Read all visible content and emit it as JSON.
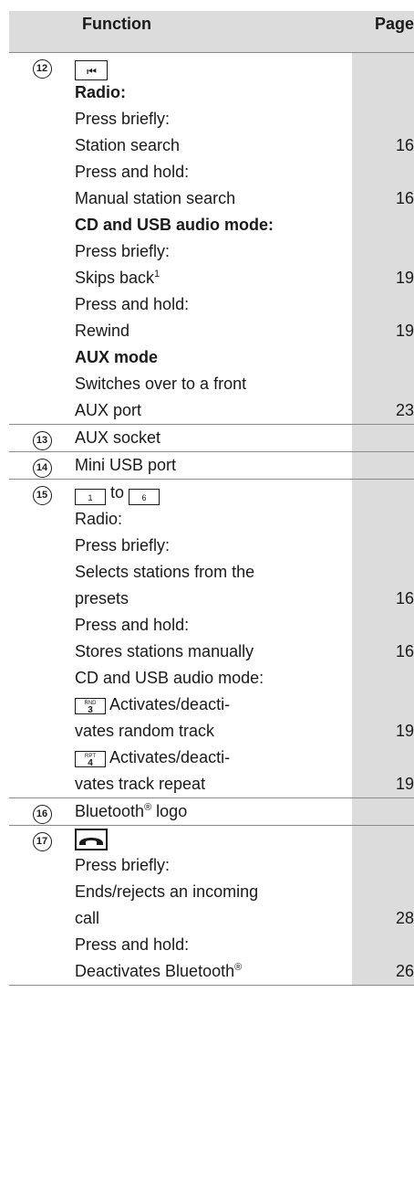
{
  "header": {
    "function": "Function",
    "page": "Page"
  },
  "rows": [
    {
      "num": "12",
      "key": "⏮",
      "lines": [
        {
          "text": "Radio:",
          "bold": true,
          "page": ""
        },
        {
          "text": "Press briefly:",
          "page": ""
        },
        {
          "text": "Station search",
          "page": "16"
        },
        {
          "text": "Press and hold:",
          "page": ""
        },
        {
          "text": "Manual station search",
          "page": "16"
        },
        {
          "text": "CD and USB audio mode:",
          "bold": true,
          "page": ""
        },
        {
          "text": "Press briefly:",
          "page": ""
        },
        {
          "text": "Skips back",
          "sup": "1",
          "page": "19"
        },
        {
          "text": "Press and hold:",
          "page": ""
        },
        {
          "text": "Rewind",
          "page": "19"
        },
        {
          "text": "AUX mode",
          "bold": true,
          "page": ""
        },
        {
          "text": "Switches over to a front",
          "page": ""
        },
        {
          "text": "AUX port",
          "page": "23"
        }
      ]
    },
    {
      "num": "13",
      "lines": [
        {
          "text": "AUX socket",
          "page": ""
        }
      ]
    },
    {
      "num": "14",
      "lines": [
        {
          "text": "Mini USB port",
          "page": ""
        }
      ]
    },
    {
      "num": "15",
      "key_from": "1",
      "key_to_word": "to",
      "key_to": "6",
      "lines": [
        {
          "text": "Radio:",
          "page": ""
        },
        {
          "text": "Press briefly:",
          "page": ""
        },
        {
          "text": "Selects stations from the",
          "page": ""
        },
        {
          "text": "presets",
          "page": "16"
        },
        {
          "text": "Press and hold:",
          "page": ""
        },
        {
          "text": "Stores stations manually",
          "page": "16"
        },
        {
          "text": "CD and USB audio mode:",
          "page": ""
        }
      ],
      "key_lines": [
        {
          "key_small": "RND",
          "key_big": "3",
          "text1": "Activates/deacti-",
          "text2": "vates random track",
          "page": "19"
        },
        {
          "key_small": "RPT",
          "key_big": "4",
          "text1": "Activates/deacti-",
          "text2": "vates track repeat",
          "page": "19"
        }
      ]
    },
    {
      "num": "16",
      "lines": [
        {
          "text": "Bluetooth",
          "sup": "®",
          "after": " logo",
          "page": ""
        }
      ]
    },
    {
      "num": "17",
      "key": "phone",
      "lines": [
        {
          "text": "Press briefly:",
          "page": ""
        },
        {
          "text": "Ends/rejects an incoming",
          "page": ""
        },
        {
          "text": "call",
          "page": "28"
        },
        {
          "text": "Press and hold:",
          "page": ""
        },
        {
          "text": "Deactivates Bluetooth",
          "sup": "®",
          "page": "26"
        }
      ]
    }
  ]
}
